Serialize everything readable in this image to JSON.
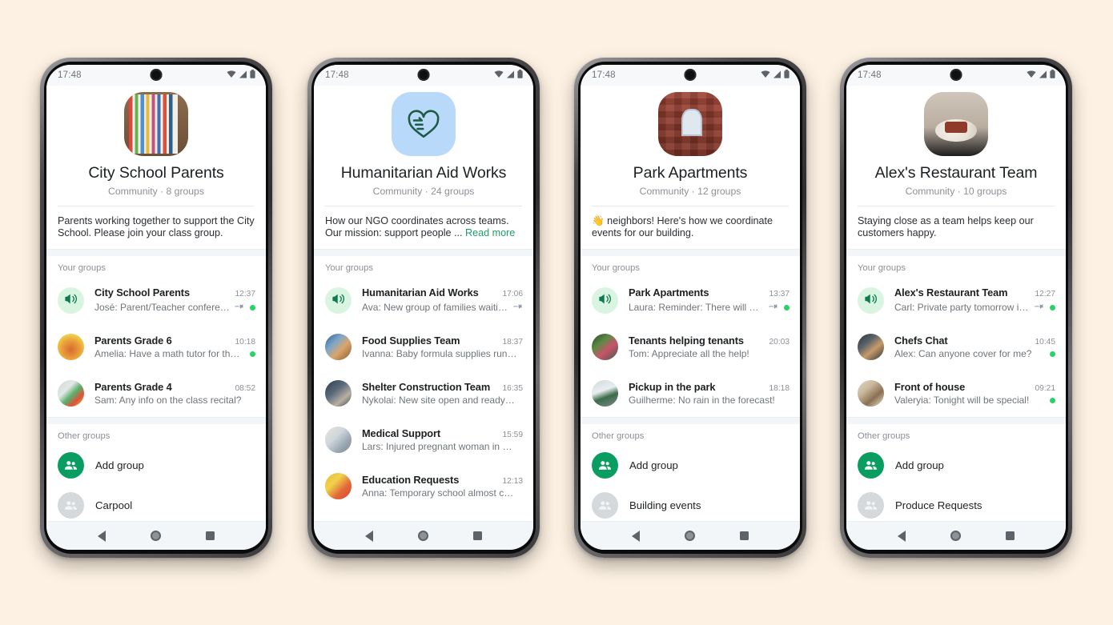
{
  "background_color": "#fdf1e3",
  "accent_green": "#0a9d62",
  "unread_dot_color": "#25d366",
  "status_bar": {
    "time": "17:48",
    "icons": [
      "wifi-icon",
      "cellular-signal-icon",
      "battery-icon"
    ]
  },
  "nav_bar": {
    "back": "nav-back-icon",
    "home": "nav-home-icon",
    "recents": "nav-recents-icon"
  },
  "common": {
    "your_groups_label": "Your groups",
    "other_groups_label": "Other groups",
    "add_group_label": "Add group",
    "back_icon": "back-arrow-icon",
    "menu_icon": "overflow-menu-icon"
  },
  "phones": [
    {
      "id": "city-school-parents",
      "avatar_style": "img-books",
      "title": "City School Parents",
      "subtitle": "Community · 8 groups",
      "description": "Parents working together to support the City School. Please join your class group.",
      "read_more": "",
      "emoji": "",
      "your_groups": [
        {
          "avatar": "announce",
          "name": "City School Parents",
          "time": "12:37",
          "message": "José: Parent/Teacher conferen…",
          "pinned": true,
          "unread": true
        },
        {
          "avatar": "av-kids",
          "name": "Parents Grade 6",
          "time": "10:18",
          "message": "Amelia: Have a math tutor for the…",
          "pinned": false,
          "unread": true
        },
        {
          "avatar": "av-paint",
          "name": "Parents Grade 4",
          "time": "08:52",
          "message": "Sam: Any info on the class recital?",
          "pinned": false,
          "unread": false
        }
      ],
      "other_groups": [
        {
          "kind": "add",
          "label": "Add group"
        },
        {
          "kind": "plain",
          "label": "Carpool"
        }
      ]
    },
    {
      "id": "humanitarian-aid-works",
      "avatar_style": "img-heart",
      "title": "Humanitarian Aid Works",
      "subtitle": "Community · 24 groups",
      "description": "How our NGO coordinates across teams. Our mission: support people ... ",
      "read_more": "Read more",
      "emoji": "",
      "your_groups": [
        {
          "avatar": "announce",
          "name": "Humanitarian Aid Works",
          "time": "17:06",
          "message": "Ava: New group of families waitin…",
          "pinned": true,
          "unread": false
        },
        {
          "avatar": "av-food",
          "name": "Food Supplies Team",
          "time": "18:37",
          "message": "Ivanna: Baby formula supplies running …",
          "pinned": false,
          "unread": false
        },
        {
          "avatar": "av-shelter",
          "name": "Shelter Construction Team",
          "time": "16:35",
          "message": "Nykolai: New site open and ready for …",
          "pinned": false,
          "unread": false
        },
        {
          "avatar": "av-med",
          "name": "Medical Support",
          "time": "15:59",
          "message": "Lars: Injured pregnant woman in need…",
          "pinned": false,
          "unread": false
        },
        {
          "avatar": "av-edu",
          "name": "Education Requests",
          "time": "12:13",
          "message": "Anna: Temporary school almost comp…",
          "pinned": false,
          "unread": false
        }
      ],
      "other_groups": []
    },
    {
      "id": "park-apartments",
      "avatar_style": "img-brick",
      "title": "Park Apartments",
      "subtitle": "Community · 12 groups",
      "description": " neighbors! Here's how we coordinate events for our building.",
      "read_more": "",
      "emoji": "👋",
      "your_groups": [
        {
          "avatar": "announce",
          "name": "Park Apartments",
          "time": "13:37",
          "message": "Laura: Reminder: There will be…",
          "pinned": true,
          "unread": true
        },
        {
          "avatar": "av-garden",
          "name": "Tenants helping tenants",
          "time": "20:03",
          "message": "Tom: Appreciate all the help!",
          "pinned": false,
          "unread": false
        },
        {
          "avatar": "av-park",
          "name": "Pickup in the park",
          "time": "18:18",
          "message": "Guilherme: No rain in the forecast!",
          "pinned": false,
          "unread": false
        }
      ],
      "other_groups": [
        {
          "kind": "add",
          "label": "Add group"
        },
        {
          "kind": "plain",
          "label": "Building events"
        }
      ]
    },
    {
      "id": "alexs-restaurant-team",
      "avatar_style": "img-food",
      "title": "Alex's Restaurant Team",
      "subtitle": "Community · 10 groups",
      "description": "Staying close as a team helps keep our customers happy.",
      "read_more": "",
      "emoji": "",
      "your_groups": [
        {
          "avatar": "announce",
          "name": "Alex's Restaurant Team",
          "time": "12:27",
          "message": "Carl: Private party tomorrow in…",
          "pinned": true,
          "unread": true
        },
        {
          "avatar": "av-chefs",
          "name": "Chefs Chat",
          "time": "10:45",
          "message": "Alex: Can anyone cover for me?",
          "pinned": false,
          "unread": true
        },
        {
          "avatar": "av-foh",
          "name": "Front of house",
          "time": "09:21",
          "message": "Valeryia: Tonight will be special!",
          "pinned": false,
          "unread": true
        }
      ],
      "other_groups": [
        {
          "kind": "add",
          "label": "Add group"
        },
        {
          "kind": "plain",
          "label": "Produce Requests"
        }
      ]
    }
  ]
}
